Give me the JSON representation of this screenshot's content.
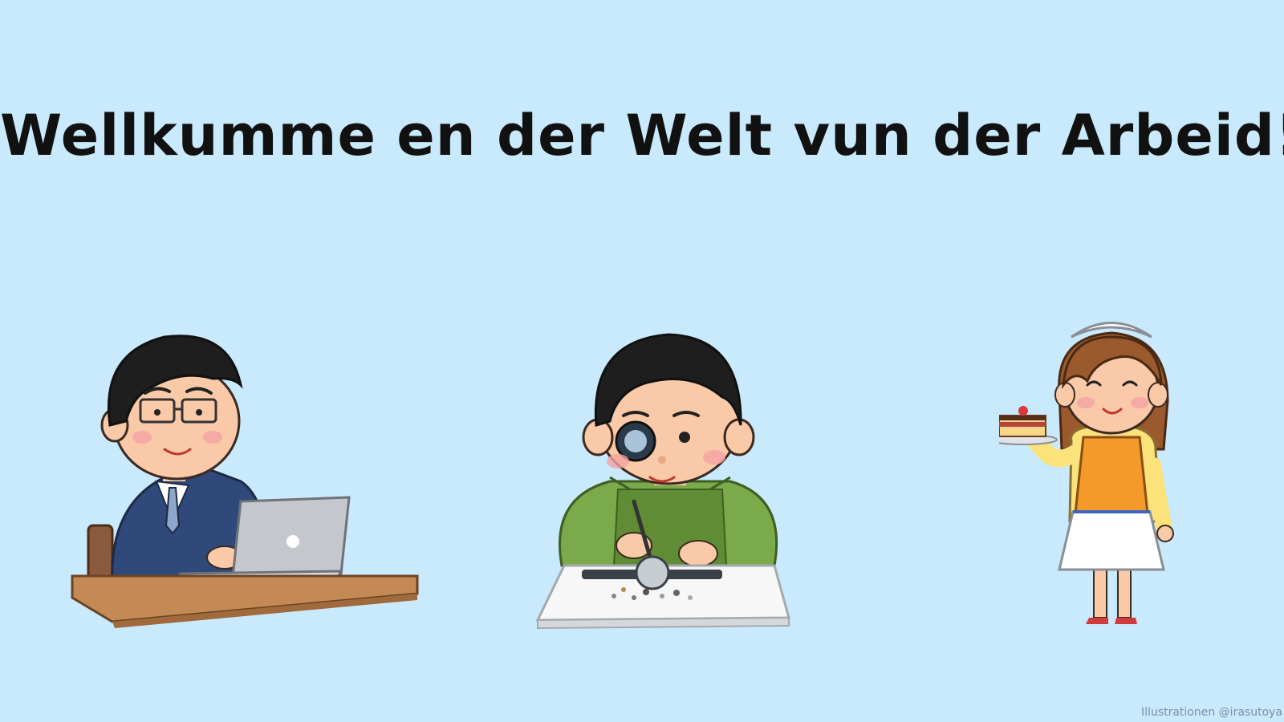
{
  "slide": {
    "title": "Wellkumme en der Welt vun der Arbeid!",
    "credit": "Illustrationen @irasutoya",
    "background_color": "#c9e9fd"
  },
  "illustrations": [
    {
      "name": "office-worker-laptop-illustration"
    },
    {
      "name": "jeweler-with-loupe-illustration"
    },
    {
      "name": "waitress-with-cake-illustration"
    }
  ]
}
